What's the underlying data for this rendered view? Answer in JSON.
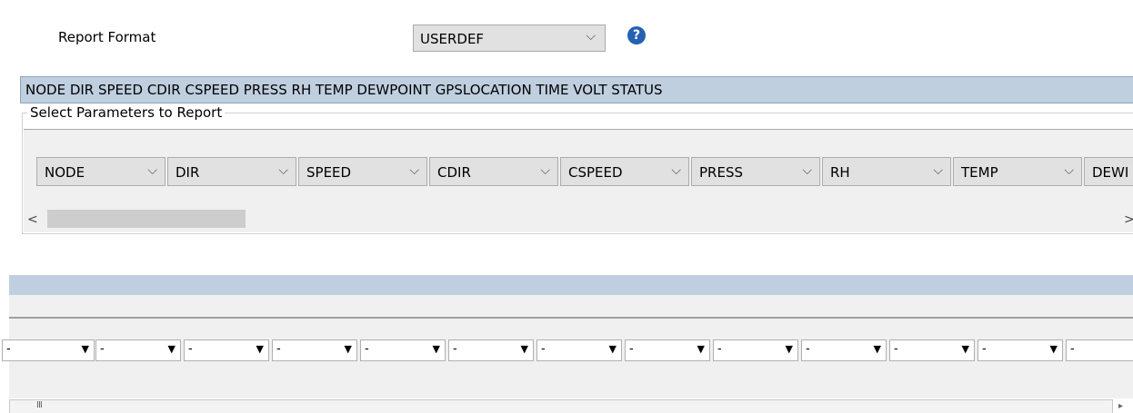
{
  "report_format": {
    "label": "Report Format",
    "selected": "USERDEF",
    "help_icon": "question-circle-icon"
  },
  "param_summary": "NODE DIR SPEED CDIR CSPEED PRESS RH TEMP DEWPOINT GPSLOCATION TIME VOLT STATUS",
  "param_group": {
    "title": "Select Parameters to Report",
    "combos": [
      "NODE",
      "DIR",
      "SPEED",
      "CDIR",
      "CSPEED",
      "PRESS",
      "RH",
      "TEMP",
      "DEWI"
    ]
  },
  "scroll": {
    "left_arrow": "<",
    "right_arrow": ">"
  },
  "lower": {
    "dropdowns": [
      "-",
      "-",
      "-",
      "-",
      "-",
      "-",
      "-",
      "-",
      "-",
      "-",
      "-",
      "-",
      "-"
    ],
    "grip": "III",
    "right_arrow": "▸"
  },
  "colors": {
    "header_bar": "#bfcfe0",
    "help_icon": "#2461b3",
    "panel_bg": "#f0f0f0"
  }
}
